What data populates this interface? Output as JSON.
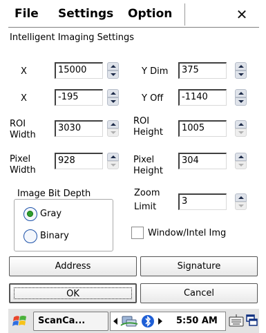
{
  "menu": {
    "file": "File",
    "settings": "Settings",
    "option": "Option",
    "close": "✕"
  },
  "title": "Intelligent Imaging Settings",
  "fields": {
    "x": {
      "label": "X",
      "value": "15000"
    },
    "ydim": {
      "label": "Y Dim",
      "value": "375"
    },
    "xoff": {
      "label": "X",
      "value": "-195"
    },
    "yoff": {
      "label": "Y Off",
      "value": "-1140"
    },
    "roi_w": {
      "label1": "ROI",
      "label2": "Width",
      "value": "3030"
    },
    "roi_h": {
      "label1": "ROI",
      "label2": "Height",
      "value": "1005"
    },
    "pix_w": {
      "label1": "Pixel",
      "label2": "Width",
      "value": "928"
    },
    "pix_h": {
      "label1": "Pixel",
      "label2": "Height",
      "value": "304"
    },
    "zoom": {
      "label1": "Zoom",
      "label2": "Limit",
      "value": "3"
    }
  },
  "bitdepth": {
    "legend": "Image Bit Depth",
    "options": [
      "Gray",
      "Binary"
    ],
    "selected": "Gray"
  },
  "checkbox": {
    "label": "Window/Intel Img",
    "checked": false
  },
  "buttons": {
    "address": "Address",
    "signature": "Signature",
    "ok": "OK",
    "cancel": "Cancel"
  },
  "taskbar": {
    "app": "ScanCa...",
    "clock": "5:50 AM"
  },
  "colors": {
    "radio_selected": "#2f9e2f",
    "bluetooth": "#1f5fd6"
  }
}
